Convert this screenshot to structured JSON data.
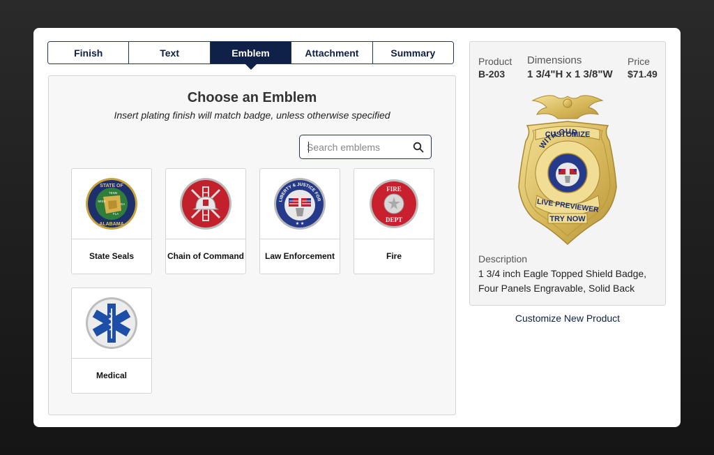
{
  "tabs": [
    {
      "label": "Finish",
      "active": false
    },
    {
      "label": "Text",
      "active": false
    },
    {
      "label": "Emblem",
      "active": true
    },
    {
      "label": "Attachment",
      "active": false
    },
    {
      "label": "Summary",
      "active": false
    }
  ],
  "panel": {
    "title": "Choose an Emblem",
    "subtitle": "Insert plating finish will match badge, unless otherwise specified"
  },
  "search": {
    "placeholder": "Search emblems",
    "value": "",
    "icon": "search-icon"
  },
  "emblems": [
    {
      "label": "State Seals",
      "seal_text": [
        "STATE OF",
        "ALABAMA",
        "TENN",
        "MISS",
        "GA",
        "FLA"
      ]
    },
    {
      "label": "Chain of Command"
    },
    {
      "label": "Law Enforcement",
      "seal_text": [
        "LIBERTY & JUSTICE FOR ALL"
      ]
    },
    {
      "label": "Fire",
      "seal_text": [
        "FIRE",
        "DEPT"
      ]
    },
    {
      "label": "Medical"
    }
  ],
  "product": {
    "product_label": "Product",
    "product_value": "B-203",
    "dimensions_label": "Dimensions",
    "dimensions_value": "1 3/4\"H x 1 3/8\"W",
    "price_label": "Price",
    "price_value": "$71.49",
    "badge_text": [
      "CUSTOMIZE",
      "WITH OUR",
      "LIVE PREVIEWER",
      "TRY NOW"
    ],
    "description_label": "Description",
    "description_text": "1 3/4 inch Eagle Topped Shield Badge, Four Panels Engravable, Solid Back"
  },
  "customize_link": "Customize New Product",
  "colors": {
    "navy": "#0f2148",
    "gold": "#e2c56a",
    "fire_red": "#c8202e",
    "medical_blue": "#1d4fa8"
  }
}
